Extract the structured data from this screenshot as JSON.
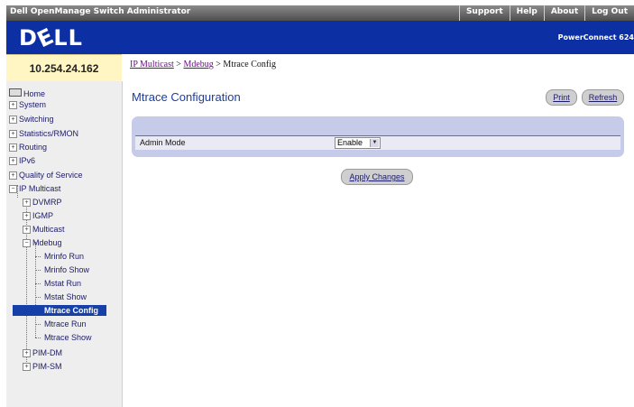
{
  "header": {
    "app_title": "Dell OpenManage Switch Administrator",
    "nav": [
      "Support",
      "Help",
      "About",
      "Log Out"
    ]
  },
  "banner": {
    "logo": "DÉLL",
    "product": "PowerConnect 624"
  },
  "ip_address": "10.254.24.162",
  "breadcrumb": {
    "items": [
      "IP Multicast",
      "Mdebug"
    ],
    "separator": " > ",
    "current": "Mtrace Config"
  },
  "page": {
    "title": "Mtrace Configuration",
    "print_label": "Print",
    "refresh_label": "Refresh",
    "apply_label": "Apply Changes"
  },
  "form": {
    "admin_mode_label": "Admin Mode",
    "admin_mode_value": "Enable"
  },
  "sidebar": {
    "home": "Home",
    "items": [
      "System",
      "Switching",
      "Statistics/RMON",
      "Routing",
      "IPv6",
      "Quality of Service",
      "IP Multicast"
    ],
    "ip_multicast_children": [
      "DVMRP",
      "IGMP",
      "Multicast",
      "Mdebug"
    ],
    "mdebug_children": [
      "Mrinfo Run",
      "Mrinfo Show",
      "Mstat Run",
      "Mstat Show",
      "Mtrace Config",
      "Mtrace Run",
      "Mtrace Show"
    ],
    "ip_multicast_tail": [
      "PIM-DM",
      "PIM-SM"
    ]
  },
  "colors": {
    "banner": "#0c2fa3",
    "panel": "#c6cbea",
    "selected": "#1640a8",
    "title": "#1b3ea3"
  }
}
